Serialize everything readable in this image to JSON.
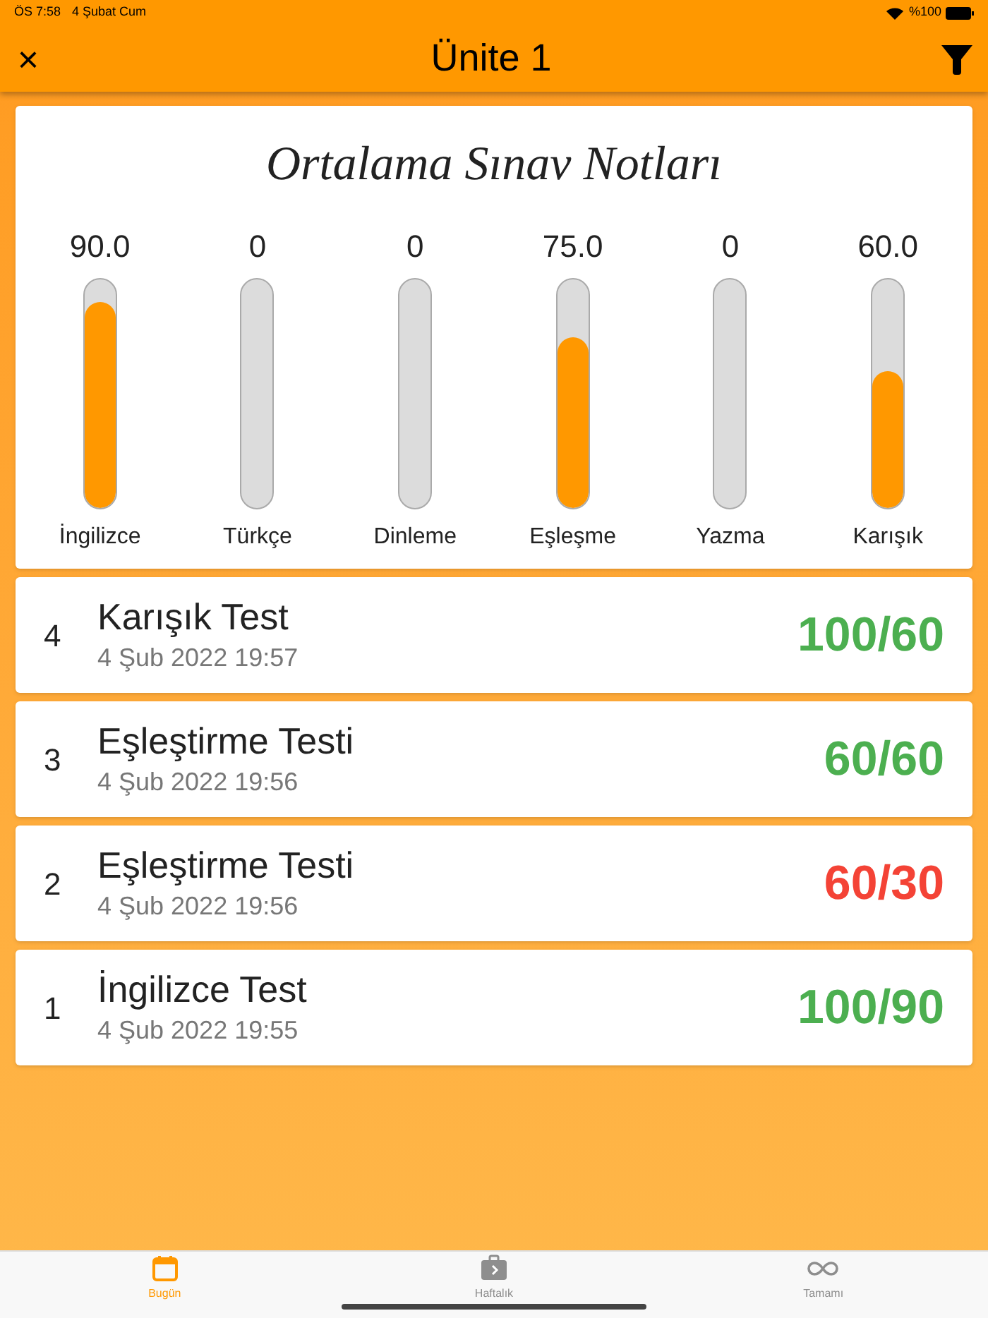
{
  "status_bar": {
    "time": "ÖS 7:58",
    "date": "4 Şubat Cum",
    "battery": "%100"
  },
  "header": {
    "close": "×",
    "title": "Ünite 1"
  },
  "averages": {
    "title": "Ortalama Sınav Notları",
    "bars": [
      {
        "value": "90.0",
        "label": "İngilizce",
        "level": 0.9
      },
      {
        "value": "0",
        "label": "Türkçe"
      },
      {
        "value": "0",
        "label": "Dinleme"
      },
      {
        "value": "75.0",
        "label": "Eşleşme",
        "level": 0.75
      },
      {
        "value": "0",
        "label": "Yazma"
      },
      {
        "value": "60.0",
        "label": "Karışık",
        "level": 0.6
      }
    ]
  },
  "tests": [
    {
      "number": "4",
      "name": "Karışık Test",
      "date": "4 Şub 2022 19:57",
      "score": "100/60",
      "color": "#4caf50"
    },
    {
      "number": "3",
      "name": "Eşleştirme Testi",
      "date": "4 Şub 2022 19:56",
      "score": "60/60",
      "color": "#4caf50"
    },
    {
      "number": "2",
      "name": "Eşleştirme Testi",
      "date": "4 Şub 2022 19:56",
      "score": "60/30",
      "color": "#f44336"
    },
    {
      "number": "1",
      "name": "İngilizce Test",
      "date": "4 Şub 2022 19:55",
      "score": "100/90",
      "color": "#4caf50"
    }
  ],
  "tab_bar": [
    {
      "label": "Bugün",
      "kind": "calendar",
      "selected": true
    },
    {
      "label": "Haftalık",
      "kind": "briefcase",
      "selected": false
    },
    {
      "label": "Tamamı",
      "kind": "infinity",
      "selected": false
    }
  ]
}
